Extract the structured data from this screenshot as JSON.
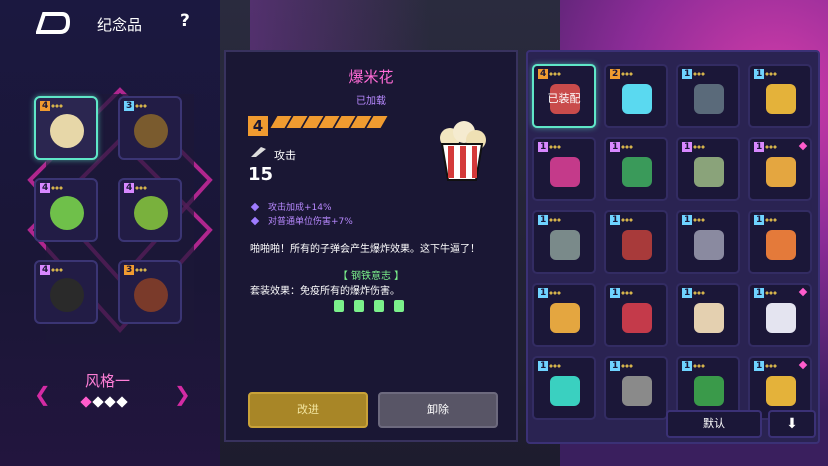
{
  "header": {
    "title": "纪念品",
    "help": "?"
  },
  "left_slots": [
    {
      "level": "4",
      "level_color": "#f09b30",
      "icon": "popcorn-icon",
      "icon_color": "#e7d7a8",
      "selected": true
    },
    {
      "level": "3",
      "level_color": "#6fd3ff",
      "icon": "coin-icon",
      "icon_color": "#7a5b2e",
      "selected": false
    },
    {
      "level": "4",
      "level_color": "#d888ff",
      "icon": "map-icon",
      "icon_color": "#6fc04a",
      "selected": false
    },
    {
      "level": "4",
      "level_color": "#d888ff",
      "icon": "map-x-icon",
      "icon_color": "#79b13d",
      "selected": false
    },
    {
      "level": "4",
      "level_color": "#d888ff",
      "icon": "helmet-icon",
      "icon_color": "#2a2a2a",
      "selected": false
    },
    {
      "level": "3",
      "level_color": "#f09b30",
      "icon": "chest-icon",
      "icon_color": "#7a3a2a",
      "selected": false
    }
  ],
  "style": {
    "label": "风格一"
  },
  "detail": {
    "name": "爆米花",
    "status": "已加载",
    "level": "4",
    "attack_label": "攻击",
    "attack_value": "15",
    "stats": [
      "攻击加成+14%",
      "对普通单位伤害+7%"
    ],
    "description": "啪啪啪！所有的子弹会产生爆炸效果。这下牛逼了！",
    "set_name": "【 钢铁意志 】",
    "set_effect": "套装效果：免疫所有的爆炸伤害。",
    "upgrade_label": "改进",
    "remove_label": "卸除"
  },
  "inventory": {
    "equipped_label": "已装配",
    "items": [
      {
        "level": "4",
        "level_color": "#f09b30",
        "icon": "popcorn-icon",
        "icon_color": "#c94b4b",
        "selected": true,
        "equipped": true,
        "dot": false
      },
      {
        "level": "2",
        "level_color": "#f09b30",
        "icon": "blaster-icon",
        "icon_color": "#5ad9f0",
        "selected": false,
        "equipped": false,
        "dot": false
      },
      {
        "level": "1",
        "level_color": "#6fd3ff",
        "icon": "scroll-icon",
        "icon_color": "#5a6a7a",
        "selected": false,
        "equipped": false,
        "dot": false
      },
      {
        "level": "1",
        "level_color": "#6fd3ff",
        "icon": "lantern-icon",
        "icon_color": "#e4b23a",
        "selected": false,
        "equipped": false,
        "dot": false
      },
      {
        "level": "1",
        "level_color": "#d888ff",
        "icon": "year-2077-icon",
        "icon_color": "#c43a8a",
        "selected": false,
        "equipped": false,
        "dot": false
      },
      {
        "level": "1",
        "level_color": "#d888ff",
        "icon": "hand-icon",
        "icon_color": "#3a9a5a",
        "selected": false,
        "equipped": false,
        "dot": false
      },
      {
        "level": "1",
        "level_color": "#d888ff",
        "icon": "jar-icon",
        "icon_color": "#8aa37a",
        "selected": false,
        "equipped": false,
        "dot": false
      },
      {
        "level": "1",
        "level_color": "#d888ff",
        "icon": "icecream-icon",
        "icon_color": "#e4a640",
        "selected": false,
        "equipped": false,
        "dot": true
      },
      {
        "level": "1",
        "level_color": "#6fd3ff",
        "icon": "skull-icon",
        "icon_color": "#7a8a8a",
        "selected": false,
        "equipped": false,
        "dot": false
      },
      {
        "level": "1",
        "level_color": "#6fd3ff",
        "icon": "book-icon",
        "icon_color": "#a83a3a",
        "selected": false,
        "equipped": false,
        "dot": false
      },
      {
        "level": "1",
        "level_color": "#6fd3ff",
        "icon": "axe-icon",
        "icon_color": "#8a8aa0",
        "selected": false,
        "equipped": false,
        "dot": false
      },
      {
        "level": "1",
        "level_color": "#6fd3ff",
        "icon": "sword-icon",
        "icon_color": "#e47a3a",
        "selected": false,
        "equipped": false,
        "dot": false
      },
      {
        "level": "1",
        "level_color": "#6fd3ff",
        "icon": "flower-icon",
        "icon_color": "#e4a640",
        "selected": false,
        "equipped": false,
        "dot": false
      },
      {
        "level": "1",
        "level_color": "#6fd3ff",
        "icon": "red-eye-icon",
        "icon_color": "#c43a4a",
        "selected": false,
        "equipped": false,
        "dot": false
      },
      {
        "level": "1",
        "level_color": "#6fd3ff",
        "icon": "card-icon",
        "icon_color": "#e4d0b0",
        "selected": false,
        "equipped": false,
        "dot": false
      },
      {
        "level": "1",
        "level_color": "#6fd3ff",
        "icon": "paper-icon",
        "icon_color": "#e4e4f0",
        "selected": false,
        "equipped": false,
        "dot": true
      },
      {
        "level": "1",
        "level_color": "#6fd3ff",
        "icon": "stick-icon",
        "icon_color": "#3ad0c0",
        "selected": false,
        "equipped": false,
        "dot": false
      },
      {
        "level": "1",
        "level_color": "#6fd3ff",
        "icon": "gauntlet-icon",
        "icon_color": "#8a8a8a",
        "selected": false,
        "equipped": false,
        "dot": false
      },
      {
        "level": "1",
        "level_color": "#6fd3ff",
        "icon": "clover-icon",
        "icon_color": "#3a9a4a",
        "selected": false,
        "equipped": false,
        "dot": false
      },
      {
        "level": "1",
        "level_color": "#6fd3ff",
        "icon": "ticket-icon",
        "icon_color": "#e4b23a",
        "selected": false,
        "equipped": false,
        "dot": true
      }
    ],
    "default_label": "默认",
    "sort_label": "⬇"
  },
  "colors": {
    "accent_pink": "#ff6bd6",
    "accent_teal": "#5fe7c8",
    "gold": "#f09b30",
    "purple_text": "#b889ff",
    "green_text": "#7bf08b"
  }
}
